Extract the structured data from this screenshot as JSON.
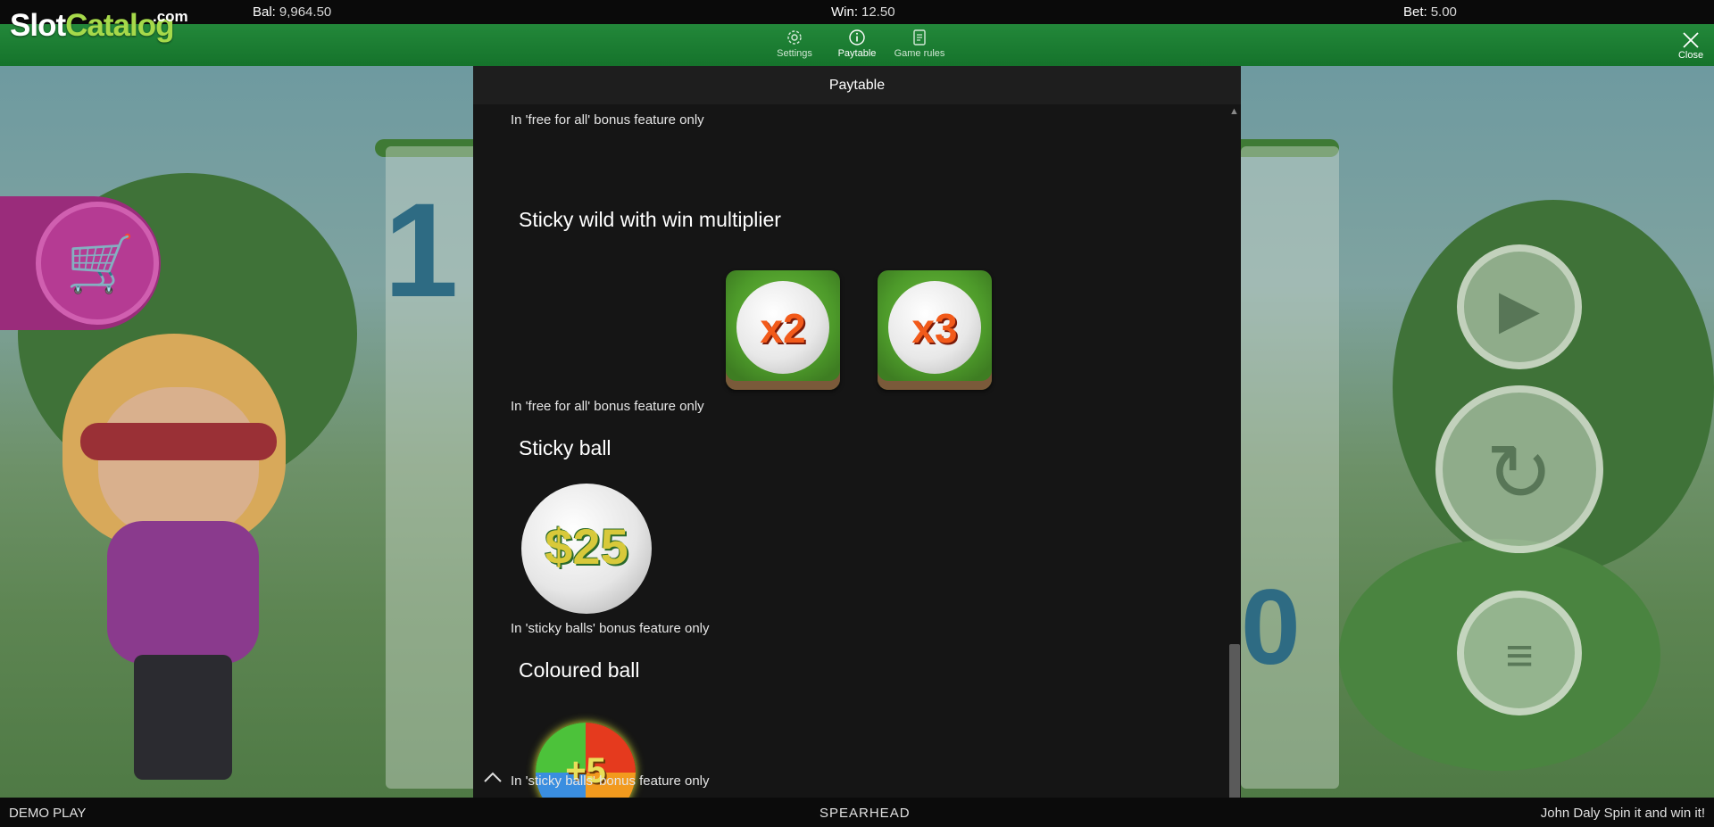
{
  "topbar": {
    "balance_label": "Bal:",
    "balance_value": "9,964.50",
    "win_label": "Win:",
    "win_value": "12.50",
    "bet_label": "Bet:",
    "bet_value": "5.00"
  },
  "logo": {
    "part1": "Slot",
    "part2": "Catalog",
    "part3": ".com"
  },
  "nav": {
    "settings_label": "Settings",
    "paytable_label": "Paytable",
    "rules_label": "Game rules",
    "close_label": "Close"
  },
  "paytable": {
    "title": "Paytable",
    "note_top": "In 'free for all' bonus feature only",
    "section1_title": "Sticky wild with win multiplier",
    "tile1": "x2",
    "tile2": "x3",
    "note1": "In 'free for all' bonus feature only",
    "section2_title": "Sticky ball",
    "sticky_ball_value": "$25",
    "note2": "In 'sticky balls' bonus feature only",
    "section3_title": "Coloured ball",
    "coloured_ball_value": "+5",
    "note3": "In 'sticky balls' bonus feature only"
  },
  "footer": {
    "mode": "DEMO PLAY",
    "brand": "SPEARHEAD",
    "tagline": "John Daly Spin it and win it!"
  },
  "colors": {
    "nav_green": "#15732b",
    "panel_bg": "#151515",
    "logo_accent": "#a6d94a"
  }
}
